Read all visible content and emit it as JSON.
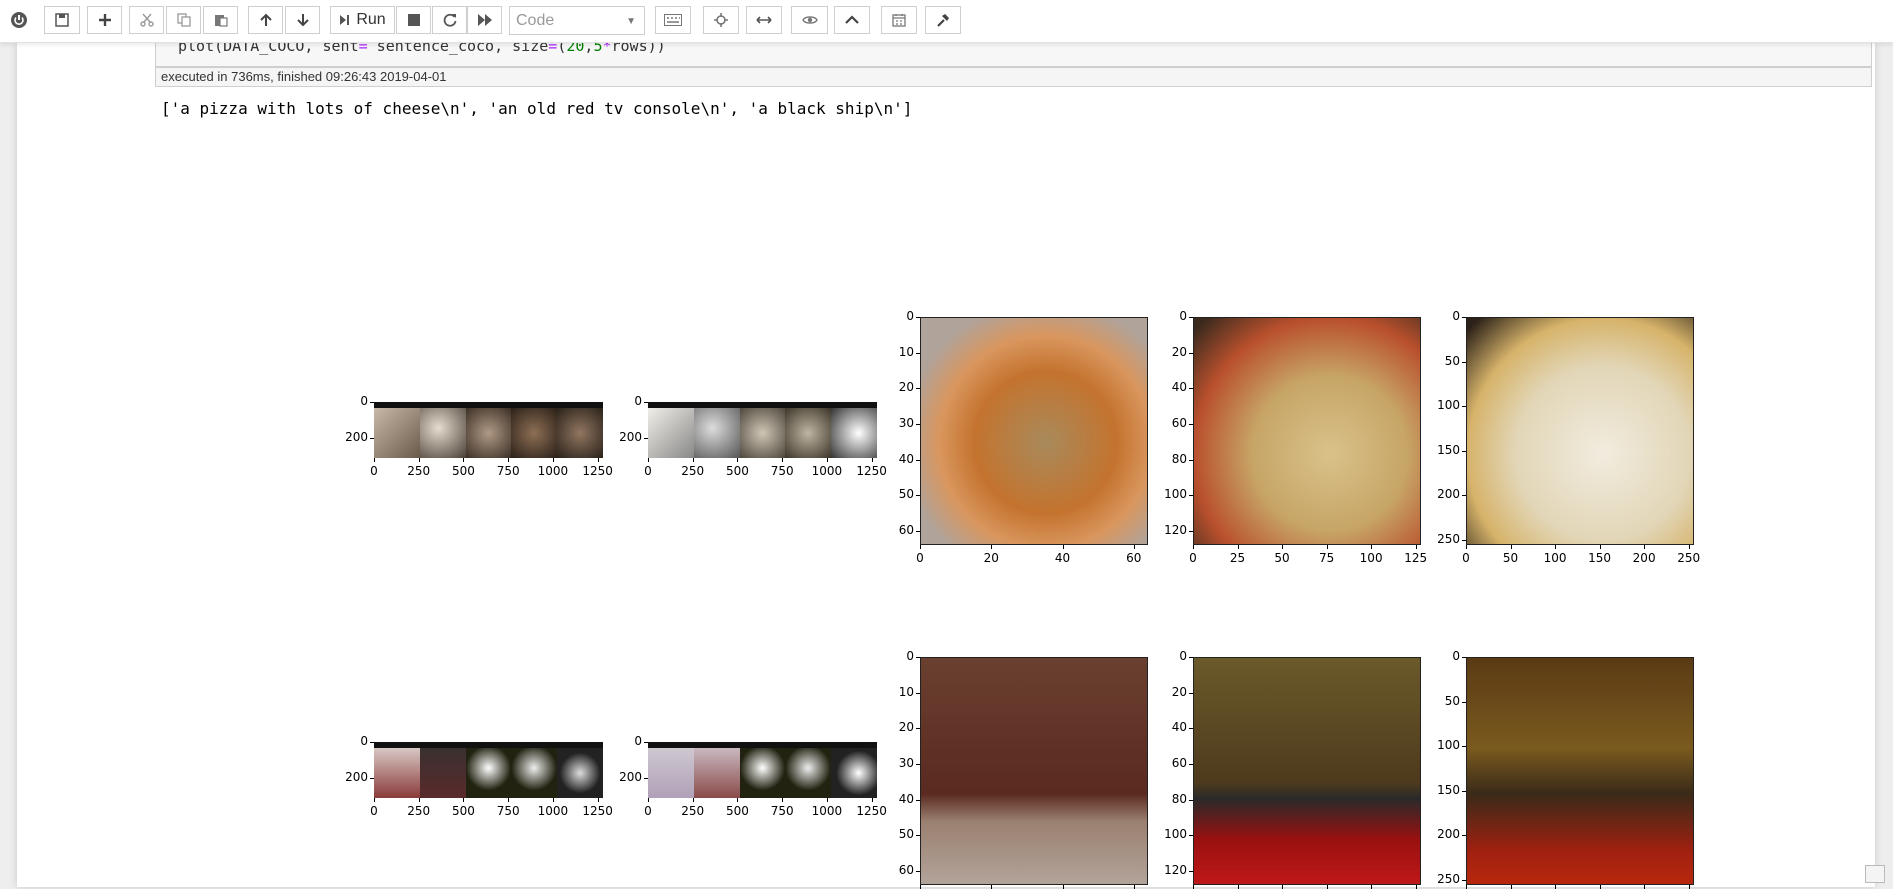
{
  "toolbar": {
    "run_label": "Run",
    "cell_type": "Code",
    "buttons": [
      "power-icon",
      "save-icon",
      "plus-icon",
      "cut-icon",
      "copy-icon",
      "paste-icon",
      "arrow-up-icon",
      "arrow-down-icon",
      "run-icon",
      "stop-icon",
      "restart-icon",
      "fast-forward-icon",
      "keyboard-icon",
      "move-icon",
      "resize-icon",
      "eye-icon",
      "chevron-up-icon",
      "calendar-icon",
      "hammer-icon"
    ]
  },
  "cell": {
    "code_prefix": "plot(DATA_COCO, sent",
    "code_eq1": "=",
    "code_mid": " sentence_coco, size",
    "code_eq2": "=",
    "code_paren": "(",
    "code_num1": "20",
    "code_comma": ",",
    "code_num2": "5",
    "code_star": "*",
    "code_rest": "rows))",
    "exec_info": "executed in 736ms, finished 09:26:43 2019-04-01",
    "output": "['a pizza with lots of cheese\\n', 'an old red tv console\\n', 'a black ship\\n']"
  },
  "plots": {
    "strip_x_ticks": [
      "0",
      "250",
      "500",
      "750",
      "1000",
      "1250"
    ],
    "strip_y_ticks": [
      "0",
      "200"
    ],
    "p64_ticks": [
      "0",
      "10",
      "20",
      "30",
      "40",
      "50",
      "60"
    ],
    "p64_y_row1": [
      "0",
      "10",
      "20",
      "30",
      "40",
      "50",
      "60"
    ],
    "p64_x": [
      "0",
      "20",
      "40",
      "60"
    ],
    "p128_x": [
      "0",
      "25",
      "50",
      "75",
      "100",
      "125"
    ],
    "p128_y": [
      "0",
      "20",
      "40",
      "60",
      "80",
      "100",
      "120"
    ],
    "p256_x": [
      "0",
      "50",
      "100",
      "150",
      "200",
      "250"
    ],
    "p256_y": [
      "0",
      "50",
      "100",
      "150",
      "200",
      "250"
    ]
  },
  "colors": {
    "toolbar_bg": "#ffffff",
    "page_bg": "#ffffff",
    "background": "#eeeeee",
    "code_number": "#008000",
    "code_operator": "#aa22ff"
  }
}
